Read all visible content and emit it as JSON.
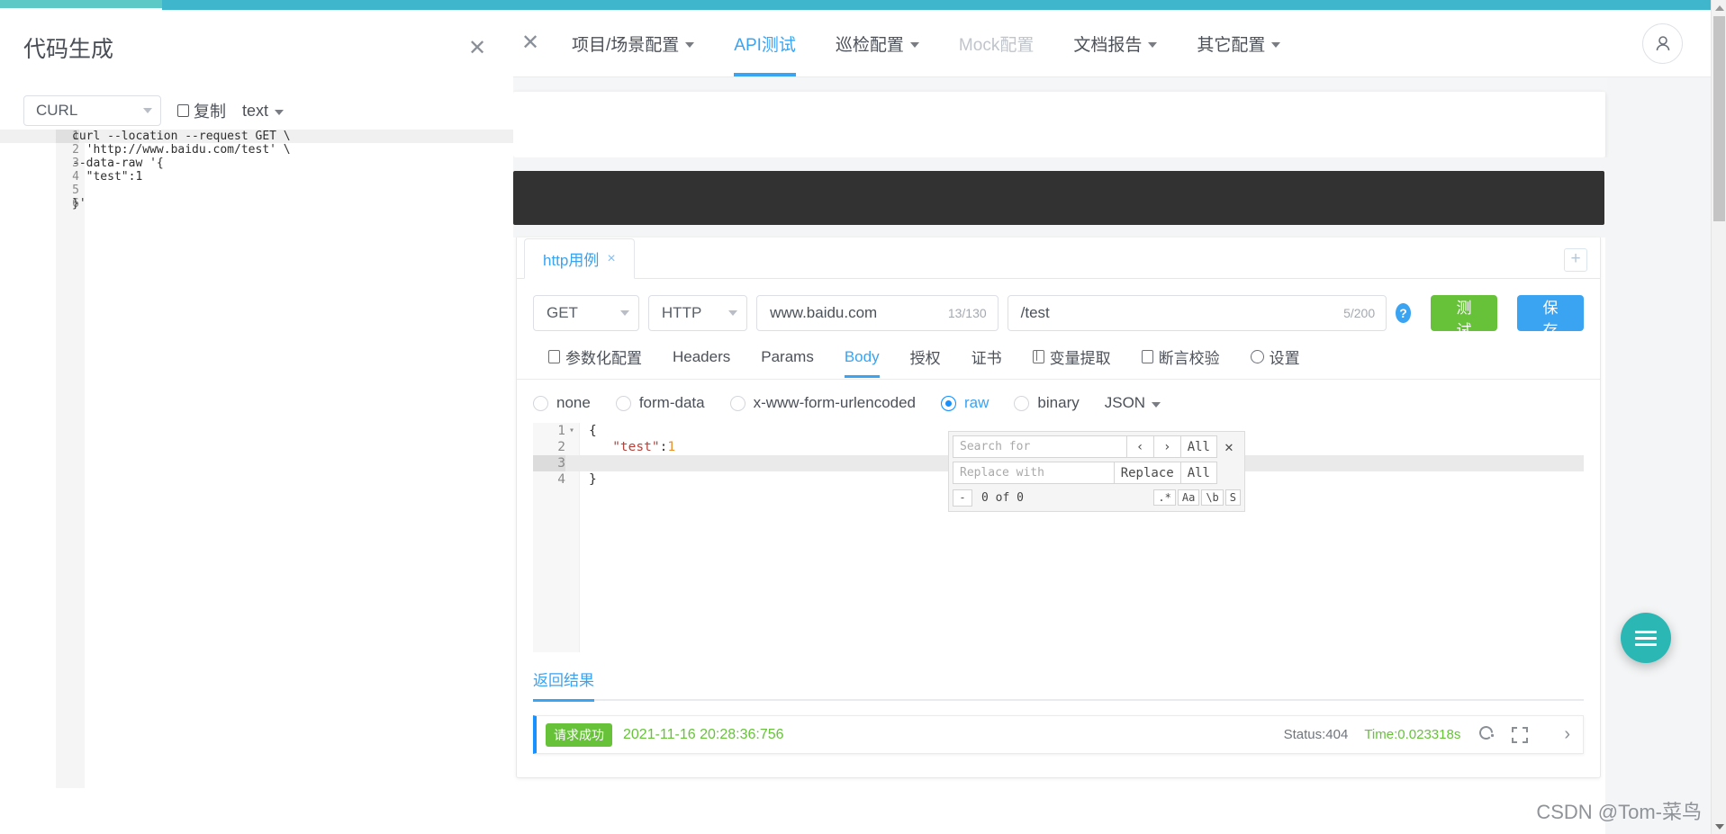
{
  "topnav": {
    "close_label": "✕",
    "items": [
      {
        "label": "项目/场景配置",
        "caret": true,
        "state": "normal"
      },
      {
        "label": "API测试",
        "caret": false,
        "state": "active"
      },
      {
        "label": "巡检配置",
        "caret": true,
        "state": "normal"
      },
      {
        "label": "Mock配置",
        "caret": false,
        "state": "disabled"
      },
      {
        "label": "文档报告",
        "caret": true,
        "state": "normal"
      },
      {
        "label": "其它配置",
        "caret": true,
        "state": "normal"
      }
    ],
    "avatar_icon": "user-icon"
  },
  "modal": {
    "title": "代码生成",
    "close_label": "✕",
    "language": "CURL",
    "copy_label": "复制",
    "copy_icon": "copy-icon",
    "format": "text",
    "code_lines": [
      {
        "no": "1",
        "text": "curl --location --request GET \\",
        "highlight": true
      },
      {
        "no": "2",
        "text": "  'http://www.baidu.com/test' \\",
        "highlight": false
      },
      {
        "no": "3",
        "text": "--data-raw '{",
        "highlight": false
      },
      {
        "no": "4",
        "text": "  \"test\":1",
        "highlight": false
      },
      {
        "no": "5",
        "text": "",
        "highlight": false
      },
      {
        "no": "6",
        "text": "}'",
        "highlight": false
      }
    ]
  },
  "case_tabs": {
    "tabs": [
      {
        "label": "http用例",
        "close": "×"
      }
    ],
    "add_label": "+"
  },
  "request": {
    "method": "GET",
    "protocol": "HTTP",
    "host": "www.baidu.com",
    "host_count": "13/130",
    "path": "/test",
    "path_count": "5/200",
    "help_label": "?",
    "test_label": "测试",
    "save_label": "保存"
  },
  "subtabs": [
    {
      "label": "参数化配置",
      "icon": "params-config-icon",
      "active": false
    },
    {
      "label": "Headers",
      "icon": "",
      "active": false
    },
    {
      "label": "Params",
      "icon": "",
      "active": false
    },
    {
      "label": "Body",
      "icon": "",
      "active": true
    },
    {
      "label": "授权",
      "icon": "",
      "active": false
    },
    {
      "label": "证书",
      "icon": "",
      "active": false
    },
    {
      "label": "变量提取",
      "icon": "variable-extract-icon",
      "active": false
    },
    {
      "label": "断言校验",
      "icon": "assertion-icon",
      "active": false
    },
    {
      "label": "设置",
      "icon": "gear-icon",
      "active": false
    }
  ],
  "body_types": [
    {
      "label": "none",
      "checked": false
    },
    {
      "label": "form-data",
      "checked": false
    },
    {
      "label": "x-www-form-urlencoded",
      "checked": false
    },
    {
      "label": "raw",
      "checked": true
    },
    {
      "label": "binary",
      "checked": false
    }
  ],
  "body_format": "JSON",
  "body_editor": {
    "lines": [
      {
        "no": "1",
        "fold": "▾",
        "text": "{",
        "highlight": false
      },
      {
        "no": "2",
        "fold": "",
        "text": "   \"test\":1",
        "highlight": false,
        "tokens": [
          {
            "t": "   ",
            "c": "plain"
          },
          {
            "t": "\"test\"",
            "c": "key"
          },
          {
            "t": ":",
            "c": "plain"
          },
          {
            "t": "1",
            "c": "num"
          }
        ]
      },
      {
        "no": "3",
        "fold": "",
        "text": "",
        "highlight": true
      },
      {
        "no": "4",
        "fold": "",
        "text": "}",
        "highlight": false
      }
    ]
  },
  "search_widget": {
    "search_placeholder": "Search for",
    "search_value": "",
    "prev_label": "‹",
    "next_label": "›",
    "all_label": "All",
    "close_label": "✕",
    "replace_placeholder": "Replace with",
    "replace_value": "",
    "replace_label": "Replace",
    "replace_all_label": "All",
    "minus_label": "-",
    "count_label": "0 of 0",
    "flags": [
      ".*",
      "Aa",
      "\\b",
      "S"
    ]
  },
  "result": {
    "tab_label": "返回结果",
    "status_tag": "请求成功",
    "timestamp": "2021-11-16 20:28:36:756",
    "status_label": "Status:404",
    "time_label": "Time:0.023318s",
    "refresh_icon": "refresh-icon",
    "expand_icon": "expand-icon",
    "chevron_icon": "chevron-right-icon"
  },
  "fab": {
    "icon": "menu-icon"
  },
  "watermark": "CSDN @Tom-菜鸟",
  "colors": {
    "accent_blue": "#3aa3f2",
    "green": "#67c23a",
    "teal": "#2bb8b5",
    "dark_bar": "#323232"
  }
}
